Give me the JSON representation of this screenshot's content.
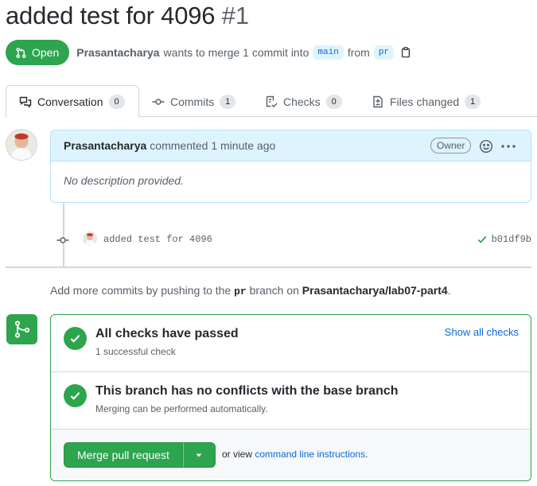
{
  "pr": {
    "title": "added test for 4096",
    "number": "#1",
    "state": "Open",
    "author": "Prasantacharya",
    "merge_text": "wants to merge 1 commit into",
    "base_branch": "main",
    "from_text": "from",
    "head_branch": "pr"
  },
  "tabs": [
    {
      "label": "Conversation",
      "count": "0",
      "icon": "comment-discussion-icon"
    },
    {
      "label": "Commits",
      "count": "1",
      "icon": "git-commit-icon"
    },
    {
      "label": "Checks",
      "count": "0",
      "icon": "checklist-icon"
    },
    {
      "label": "Files changed",
      "count": "1",
      "icon": "file-diff-icon"
    }
  ],
  "comment": {
    "author": "Prasantacharya",
    "action": "commented",
    "time": "1 minute ago",
    "role_badge": "Owner",
    "body": "No description provided."
  },
  "commit": {
    "message": "added test for 4096",
    "sha": "b01df9b"
  },
  "push_hint": {
    "prefix": "Add more commits by pushing to the",
    "branch": "pr",
    "middle": "branch on",
    "repo": "Prasantacharya/lab07-part4",
    "suffix": "."
  },
  "merge": {
    "checks_title": "All checks have passed",
    "checks_sub": "1 successful check",
    "show_all": "Show all checks",
    "conflicts_title": "This branch has no conflicts with the base branch",
    "conflicts_sub": "Merging can be performed automatically.",
    "button": "Merge pull request",
    "or_view": "or view",
    "cli_link": "command line instructions",
    "cli_suffix": "."
  },
  "colors": {
    "success": "#2da44e",
    "link": "#0969da",
    "text_muted": "#57606a",
    "comment_header_bg": "#ddf4ff"
  }
}
